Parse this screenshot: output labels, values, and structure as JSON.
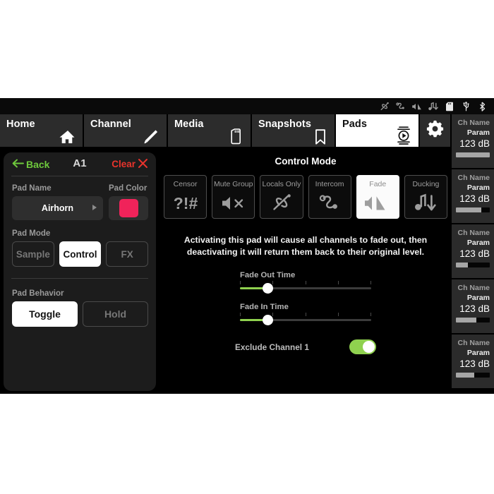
{
  "statusbar": {
    "icons": [
      {
        "name": "locals-only-icon"
      },
      {
        "name": "intercom-icon"
      },
      {
        "name": "fade-icon"
      },
      {
        "name": "ducking-icon"
      },
      {
        "name": "sdcard-icon"
      },
      {
        "name": "usb-icon"
      },
      {
        "name": "bluetooth-icon"
      }
    ]
  },
  "nav": {
    "tabs": [
      {
        "label": "Home",
        "icon": "home-icon",
        "active": false
      },
      {
        "label": "Channel",
        "icon": "pencil-icon",
        "active": false
      },
      {
        "label": "Media",
        "icon": "sdcard-icon",
        "active": false
      },
      {
        "label": "Snapshots",
        "icon": "bookmark-icon",
        "active": false
      },
      {
        "label": "Pads",
        "icon": "pad-play-icon",
        "active": true
      }
    ],
    "settings_icon": "gear-icon"
  },
  "pad_panel": {
    "back_label": "Back",
    "pad_id": "A1",
    "clear_label": "Clear",
    "pad_name_label": "Pad Name",
    "pad_name_value": "Airhorn",
    "pad_color_label": "Pad Color",
    "pad_color_value": "#f0235a",
    "pad_mode_label": "Pad Mode",
    "pad_modes": [
      {
        "label": "Sample",
        "selected": false
      },
      {
        "label": "Control",
        "selected": true
      },
      {
        "label": "FX",
        "selected": false
      }
    ],
    "pad_behavior_label": "Pad Behavior",
    "pad_behaviors": [
      {
        "label": "Toggle",
        "selected": true
      },
      {
        "label": "Hold",
        "selected": false
      }
    ]
  },
  "control_mode": {
    "title": "Control Mode",
    "tiles": [
      {
        "label": "Censor",
        "icon": "censor-icon",
        "selected": false
      },
      {
        "label": "Mute Group",
        "icon": "mute-icon",
        "selected": false
      },
      {
        "label": "Locals Only",
        "icon": "phone-off-icon",
        "selected": false
      },
      {
        "label": "Intercom",
        "icon": "intercom-icon",
        "selected": false
      },
      {
        "label": "Fade",
        "icon": "fade-icon",
        "selected": true
      },
      {
        "label": "Ducking",
        "icon": "ducking-icon",
        "selected": false
      }
    ],
    "description": "Activating this pad will cause all channels to fade out, then deactivating it will return them back to their original level.",
    "sliders": [
      {
        "label": "Fade Out Time",
        "percent": 21
      },
      {
        "label": "Fade In Time",
        "percent": 21
      }
    ],
    "toggle": {
      "label": "Exclude Channel 1",
      "on": true
    },
    "accent_green": "#8fd14f"
  },
  "channel_rail": {
    "strips": [
      {
        "name": "Ch Name",
        "param": "Param",
        "value": "123 dB",
        "meter": 100
      },
      {
        "name": "Ch Name",
        "param": "Param",
        "value": "123 dB",
        "meter": 75
      },
      {
        "name": "Ch Name",
        "param": "Param",
        "value": "123 dB",
        "meter": 35
      },
      {
        "name": "Ch Name",
        "param": "Param",
        "value": "123 dB",
        "meter": 60
      },
      {
        "name": "Ch Name",
        "param": "Param",
        "value": "123 dB",
        "meter": 55
      }
    ]
  }
}
